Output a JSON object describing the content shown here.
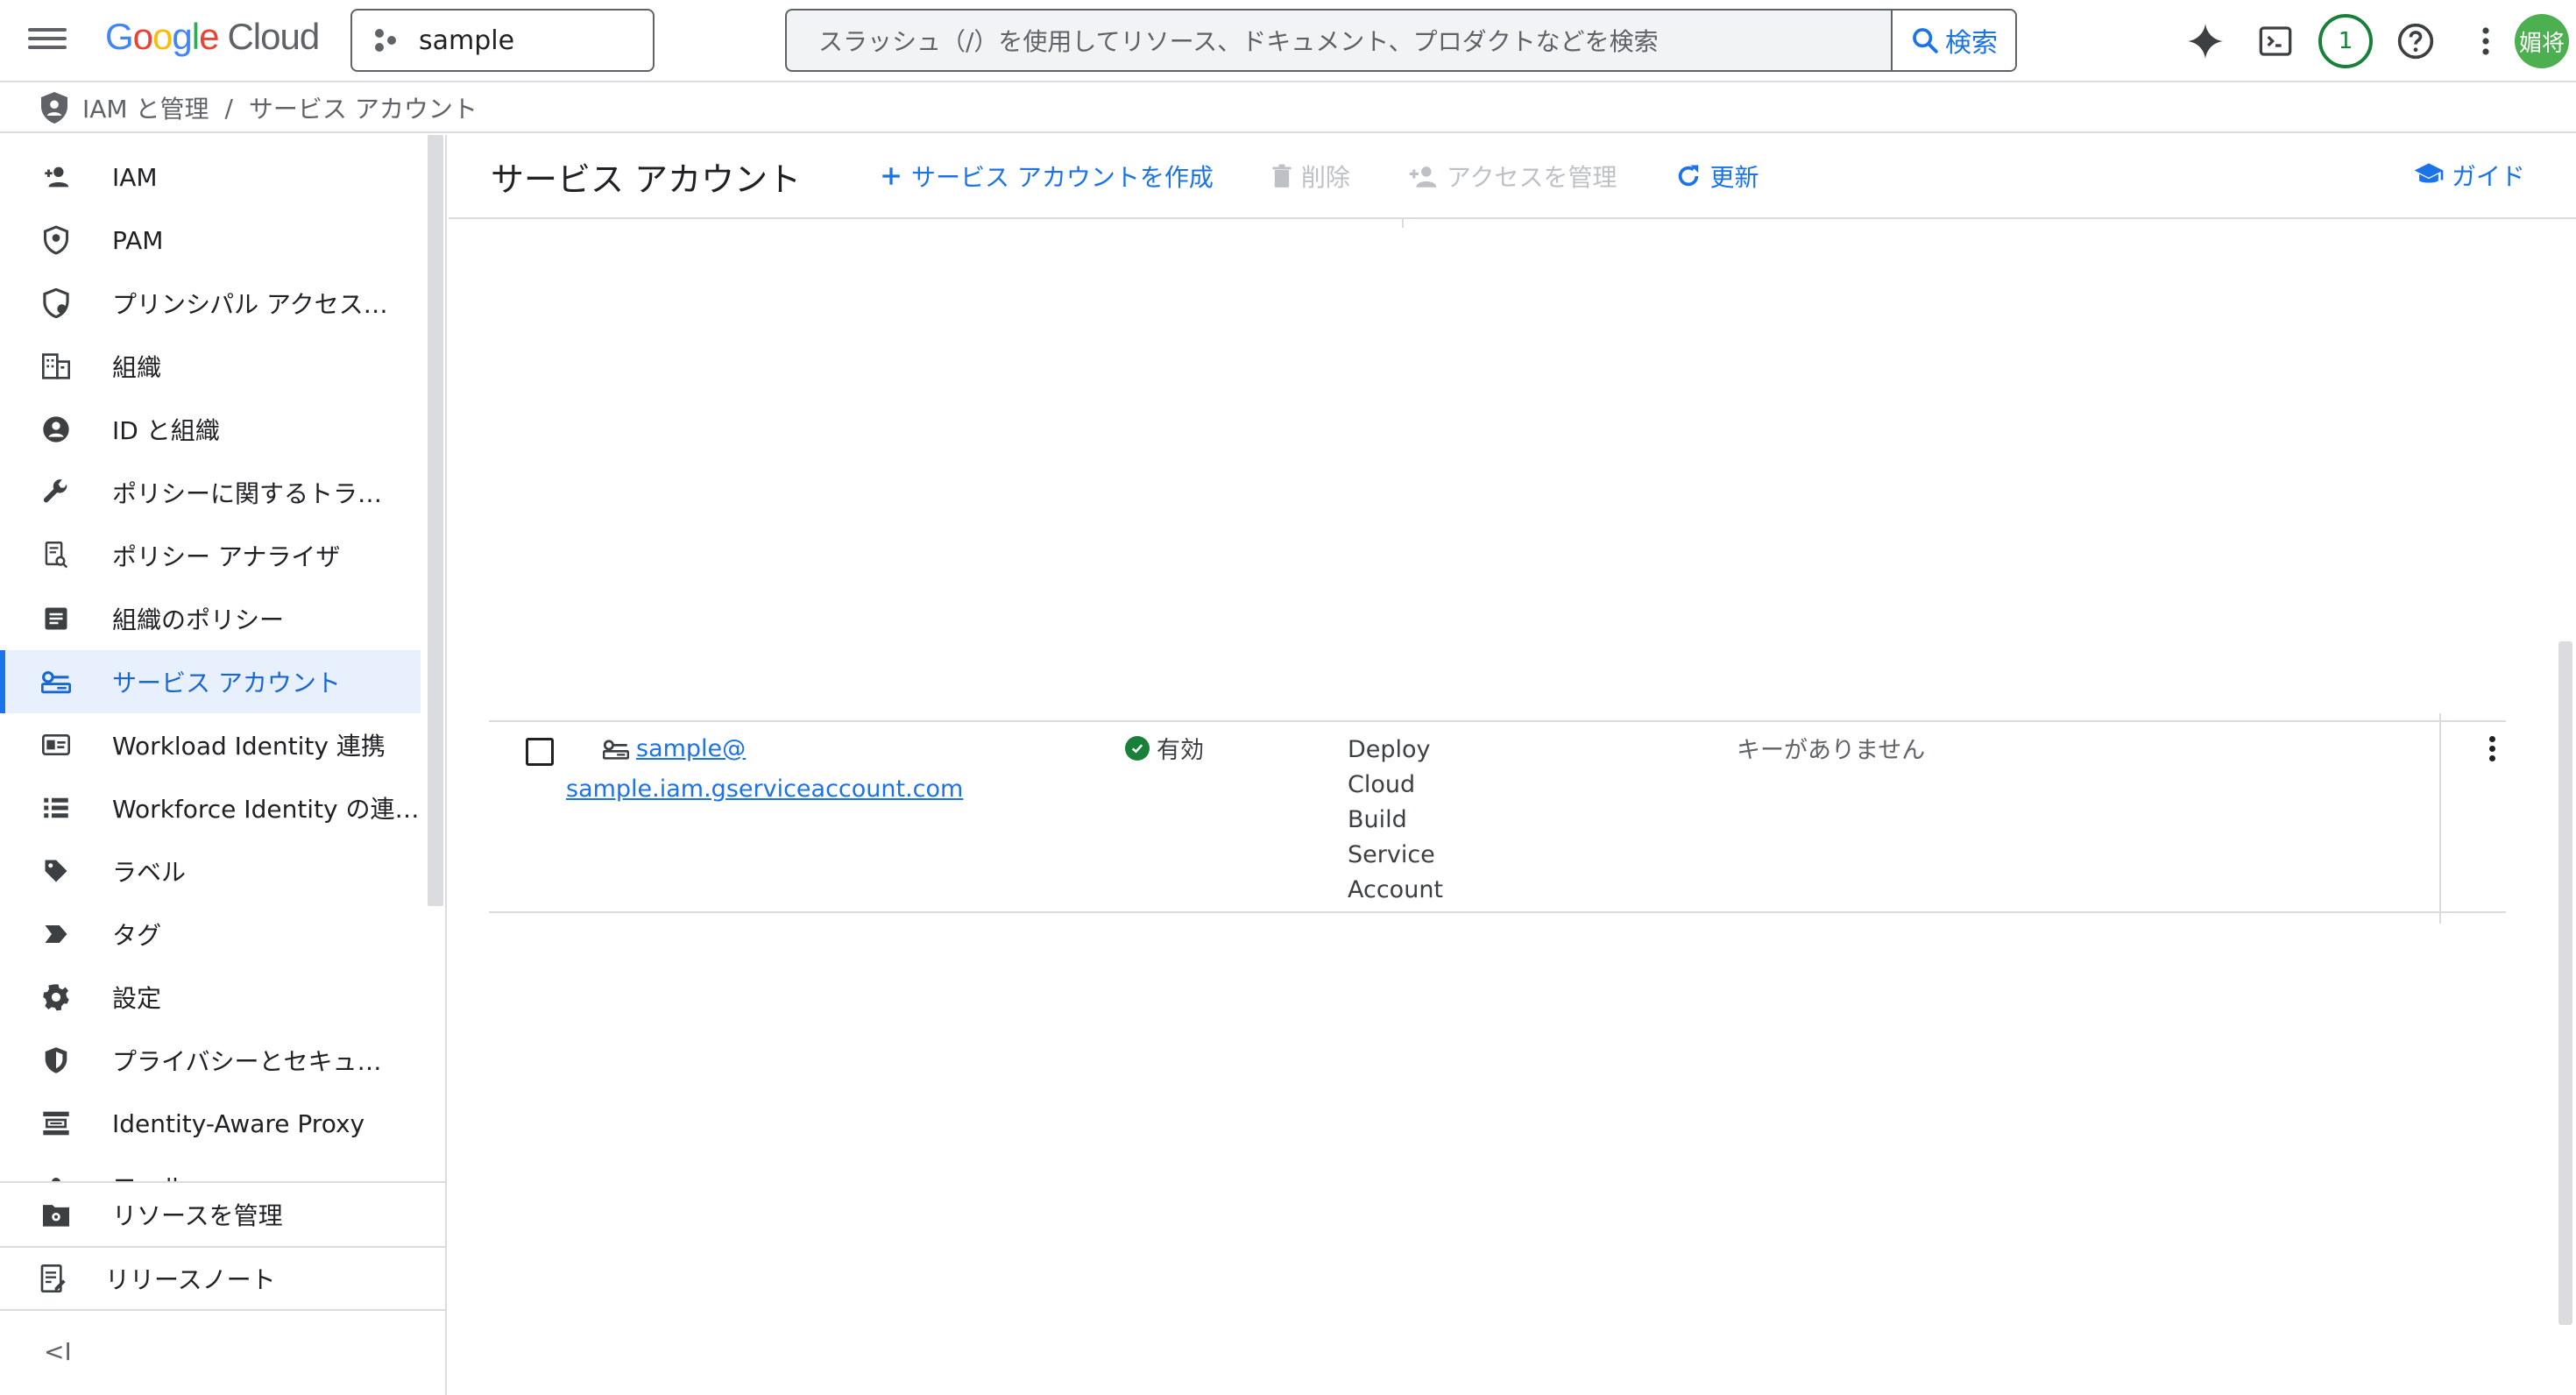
{
  "header": {
    "logo": {
      "g": "G",
      "o1": "o",
      "o2": "o",
      "g2": "g",
      "l": "l",
      "e": "e",
      "cloud": "Cloud"
    },
    "project_name": "sample",
    "search_placeholder": "スラッシュ（/）を使用してリソース、ドキュメント、プロダクトなどを検索",
    "search_button": "検索",
    "notification_count": "1",
    "avatar_initials": "媚将"
  },
  "breadcrumb": {
    "root": "IAM と管理",
    "sep": "/",
    "current": "サービス アカウント"
  },
  "sidebar": {
    "items": [
      {
        "label": "IAM",
        "icon": "person-add-icon"
      },
      {
        "label": "PAM",
        "icon": "shield-icon"
      },
      {
        "label": "プリンシパル アクセス…",
        "icon": "shield-settings-icon"
      },
      {
        "label": "組織",
        "icon": "building-icon"
      },
      {
        "label": "ID と組織",
        "icon": "account-circle-icon"
      },
      {
        "label": "ポリシーに関するトラ…",
        "icon": "wrench-icon"
      },
      {
        "label": "ポリシー アナライザ",
        "icon": "policy-search-icon"
      },
      {
        "label": "組織のポリシー",
        "icon": "list-doc-icon"
      },
      {
        "label": "サービス アカウント",
        "icon": "service-account-icon",
        "active": true
      },
      {
        "label": "Workload Identity 連携",
        "icon": "id-card-icon"
      },
      {
        "label": "Workforce Identity の連…",
        "icon": "list-icon"
      },
      {
        "label": "ラベル",
        "icon": "label-icon"
      },
      {
        "label": "タグ",
        "icon": "tag-icon"
      },
      {
        "label": "設定",
        "icon": "gear-icon"
      },
      {
        "label": "プライバシーとセキュ…",
        "icon": "security-shield-icon"
      },
      {
        "label": "Identity-Aware Proxy",
        "icon": "proxy-icon"
      },
      {
        "label": "ロール",
        "icon": "role-icon"
      }
    ],
    "manage_resources": "リソースを管理",
    "release_notes": "リリースノート",
    "collapse_label": "<I"
  },
  "toolbar": {
    "title": "サービス アカウント",
    "create": "サービス アカウントを作成",
    "delete": "削除",
    "manage_access": "アクセスを管理",
    "refresh": "更新",
    "guide": "ガイド"
  },
  "table": {
    "rows": [
      {
        "email_line1": "sample@",
        "email_line2": "sample.iam.gserviceaccount.com",
        "status": "有効",
        "description": [
          "Deploy",
          "Cloud",
          "Build",
          "Service",
          "Account"
        ],
        "keys": "キーがありません"
      }
    ]
  },
  "colors": {
    "accent": "#1a73e8",
    "active_bg": "#e8f0fe",
    "status_ok": "#188038",
    "avatar": "#4caf50"
  }
}
